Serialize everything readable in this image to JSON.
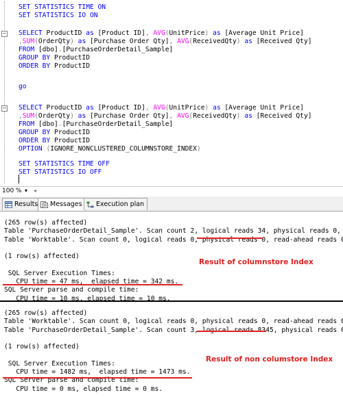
{
  "editor": {
    "block1": [
      {
        "parts": [
          {
            "t": "SET STATISTICS TIME ",
            "c": "kw"
          },
          {
            "t": "ON",
            "c": "kw"
          }
        ]
      },
      {
        "parts": [
          {
            "t": "SET STATISTICS IO ",
            "c": "kw"
          },
          {
            "t": "ON",
            "c": "kw"
          }
        ]
      }
    ],
    "query1": [
      {
        "parts": [
          {
            "t": "SELECT ",
            "c": "kw"
          },
          {
            "t": "ProductID ",
            "c": "tx"
          },
          {
            "t": "as ",
            "c": "kw"
          },
          {
            "t": "[Product ID]",
            "c": "tx"
          },
          {
            "t": ", ",
            "c": "gr"
          },
          {
            "t": "AVG",
            "c": "fn"
          },
          {
            "t": "(",
            "c": "gr"
          },
          {
            "t": "UnitPrice",
            "c": "tx"
          },
          {
            "t": ") ",
            "c": "gr"
          },
          {
            "t": "as ",
            "c": "kw"
          },
          {
            "t": "[Average Unit Price]",
            "c": "tx"
          }
        ]
      },
      {
        "parts": [
          {
            "t": ",",
            "c": "gr"
          },
          {
            "t": "SUM",
            "c": "fn"
          },
          {
            "t": "(",
            "c": "gr"
          },
          {
            "t": "OrderQty",
            "c": "tx"
          },
          {
            "t": ") ",
            "c": "gr"
          },
          {
            "t": "as ",
            "c": "kw"
          },
          {
            "t": "[Purchase Order Qty]",
            "c": "tx"
          },
          {
            "t": ", ",
            "c": "gr"
          },
          {
            "t": "AVG",
            "c": "fn"
          },
          {
            "t": "(",
            "c": "gr"
          },
          {
            "t": "ReceivedQty",
            "c": "tx"
          },
          {
            "t": ") ",
            "c": "gr"
          },
          {
            "t": "as ",
            "c": "kw"
          },
          {
            "t": "[Received Qty]",
            "c": "tx"
          }
        ]
      },
      {
        "parts": [
          {
            "t": "FROM ",
            "c": "kw"
          },
          {
            "t": "[dbo]",
            "c": "tx"
          },
          {
            "t": ".",
            "c": "gr"
          },
          {
            "t": "[PurchaseOrderDetail_Sample]",
            "c": "tx"
          }
        ]
      },
      {
        "parts": [
          {
            "t": "GROUP BY ",
            "c": "kw"
          },
          {
            "t": "ProductID",
            "c": "tx"
          }
        ]
      },
      {
        "parts": [
          {
            "t": "ORDER BY ",
            "c": "kw"
          },
          {
            "t": "ProductID",
            "c": "tx"
          }
        ]
      }
    ],
    "go": "go",
    "query2": [
      {
        "parts": [
          {
            "t": "SELECT ",
            "c": "kw"
          },
          {
            "t": "ProductID ",
            "c": "tx"
          },
          {
            "t": "as ",
            "c": "kw"
          },
          {
            "t": "[Product ID]",
            "c": "tx"
          },
          {
            "t": ", ",
            "c": "gr"
          },
          {
            "t": "AVG",
            "c": "fn"
          },
          {
            "t": "(",
            "c": "gr"
          },
          {
            "t": "UnitPrice",
            "c": "tx"
          },
          {
            "t": ") ",
            "c": "gr"
          },
          {
            "t": "as ",
            "c": "kw"
          },
          {
            "t": "[Average Unit Price]",
            "c": "tx"
          }
        ]
      },
      {
        "parts": [
          {
            "t": ",",
            "c": "gr"
          },
          {
            "t": "SUM",
            "c": "fn"
          },
          {
            "t": "(",
            "c": "gr"
          },
          {
            "t": "OrderQty",
            "c": "tx"
          },
          {
            "t": ") ",
            "c": "gr"
          },
          {
            "t": "as ",
            "c": "kw"
          },
          {
            "t": "[Purchase Order Qty]",
            "c": "tx"
          },
          {
            "t": ", ",
            "c": "gr"
          },
          {
            "t": "AVG",
            "c": "fn"
          },
          {
            "t": "(",
            "c": "gr"
          },
          {
            "t": "ReceivedQty",
            "c": "tx"
          },
          {
            "t": ") ",
            "c": "gr"
          },
          {
            "t": "as ",
            "c": "kw"
          },
          {
            "t": "[Received Qty]",
            "c": "tx"
          }
        ]
      },
      {
        "parts": [
          {
            "t": "FROM ",
            "c": "kw"
          },
          {
            "t": "[dbo]",
            "c": "tx"
          },
          {
            "t": ".",
            "c": "gr"
          },
          {
            "t": "[PurchaseOrderDetail_Sample]",
            "c": "tx"
          }
        ]
      },
      {
        "parts": [
          {
            "t": "GROUP BY ",
            "c": "kw"
          },
          {
            "t": "ProductID",
            "c": "tx"
          }
        ]
      },
      {
        "parts": [
          {
            "t": "ORDER BY ",
            "c": "kw"
          },
          {
            "t": "ProductID",
            "c": "tx"
          }
        ]
      },
      {
        "parts": [
          {
            "t": "OPTION ",
            "c": "kw"
          },
          {
            "t": "(",
            "c": "gr"
          },
          {
            "t": "IGNORE_NONCLUSTERED_COLUMNSTORE_INDEX",
            "c": "tx"
          },
          {
            "t": ")",
            "c": "gr"
          }
        ]
      }
    ],
    "block2": [
      {
        "parts": [
          {
            "t": "SET STATISTICS TIME ",
            "c": "kw"
          },
          {
            "t": "OFF",
            "c": "kw"
          }
        ]
      },
      {
        "parts": [
          {
            "t": "SET STATISTICS IO ",
            "c": "kw"
          },
          {
            "t": "OFF",
            "c": "kw"
          }
        ]
      }
    ],
    "fold_symbol": "−"
  },
  "zoom": {
    "value": "100 %",
    "dropdown_icon": "dropdown-arrow-icon",
    "arrow": "◂"
  },
  "tabs": [
    {
      "label": "Results",
      "icon": "grid-icon",
      "active": false
    },
    {
      "label": "Messages",
      "icon": "messages-icon",
      "active": true
    },
    {
      "label": "Execution plan",
      "icon": "execution-plan-icon",
      "active": false
    }
  ],
  "messages": {
    "section1": [
      "(265 row(s) affected)",
      "Table 'PurchaseOrderDetail_Sample'. Scan count 2, logical reads 34, physical reads 0,",
      "Table 'Worktable'. Scan count 0, logical reads 0, physical reads 0, read-ahead reads 0",
      "",
      "(1 row(s) affected)",
      "",
      " SQL Server Execution Times:",
      "   CPU time = 47 ms,  elapsed time = 342 ms.",
      "SQL Server parse and compile time:",
      "   CPU time = 10 ms, elapsed time = 10 ms."
    ],
    "section2": [
      "(265 row(s) affected)",
      "Table 'Worktable'. Scan count 0, logical reads 0, physical reads 0, read-ahead reads 0",
      "Table 'PurchaseOrderDetail_Sample'. Scan count 3, logical reads 8345, physical reads 0",
      "",
      "(1 row(s) affected)",
      "",
      " SQL Server Execution Times:",
      "   CPU time = 1482 ms,  elapsed time = 1473 ms.",
      "SQL Server parse and compile time:",
      "   CPU time = 0 ms, elapsed time = 0 ms."
    ],
    "annotation1": "Result of columnstore Index",
    "annotation2": "Result of non columstore Index",
    "highlight_color": "#e02020"
  }
}
